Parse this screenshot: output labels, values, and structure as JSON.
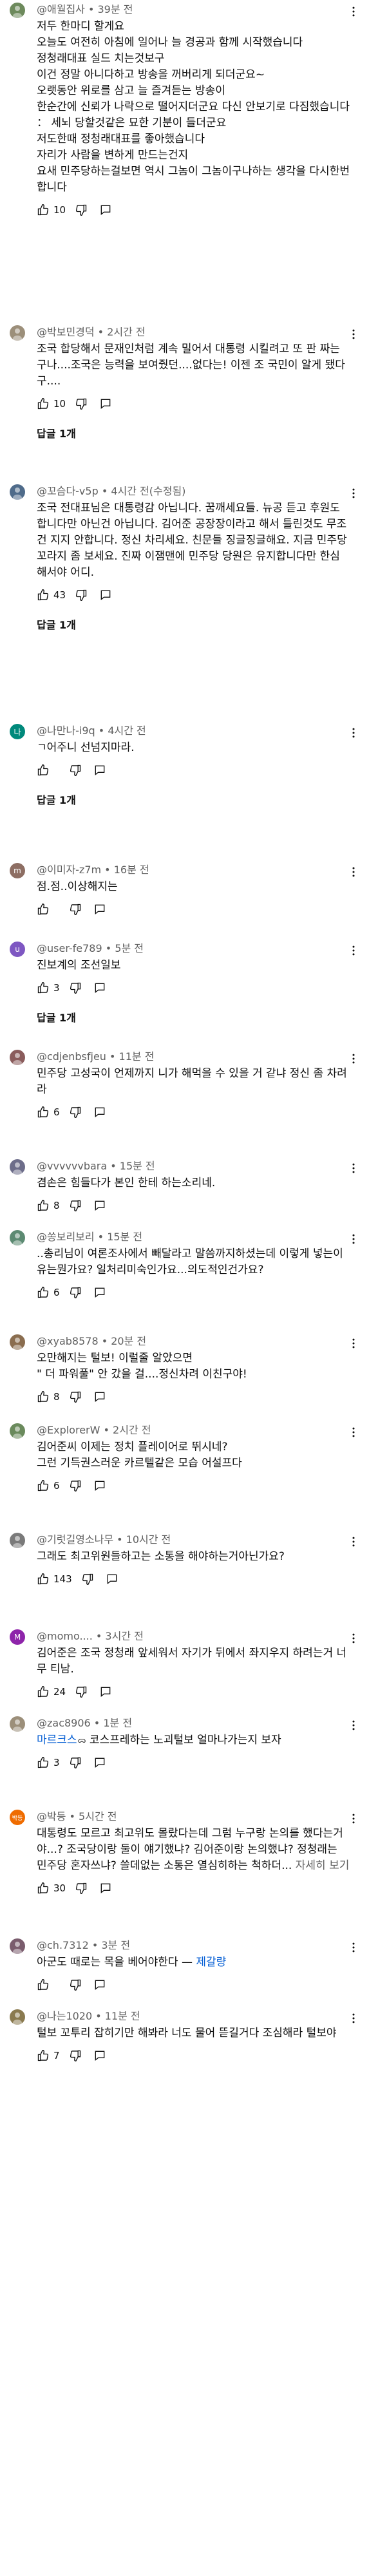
{
  "colors": {
    "meta": "#606060",
    "text": "#0f0f0f",
    "link": "#065fd4"
  },
  "comments": [
    {
      "avatar": "photo",
      "meta": "@애월집사 • 39분 전",
      "text": "저두 한마디 할게요\n오늘도 여전히 아침에 일어나 늘 경공과 함께 시작했습니다\n정청래대표 실드 치는것보구\n이건 정말 아니다하고 방송을 꺼버리게 되더군요~\n오랫동안 위로를 삼고 늘 즐겨듣는 방송이\n한순간에 신뢰가 나락으로 떨어지더군요 다신 안보기로 다짐했습니다 ： 세뇌 당할것같은 묘한 기분이 들더군요\n저도한때 정청래대표를 좋아했습니다\n자리가 사람을 변하게 만드는건지\n요새 민주당하는걸보면 역시 그놈이 그놈이구나하는 생각을 다시한번합니다",
      "likes": "10",
      "replies": ""
    },
    {
      "avatar": "photo",
      "meta": "@박보민경덕 • 2시간 전",
      "text": "조국 합당해서 문재인처럼 계속 밀어서 대통령 시킬려고 또 판 짜는구나....조국은 능력을 보여줬던....없다는! 이젠 조 국민이 알게 됐다구....",
      "likes": "10",
      "replies": "답글 1개"
    },
    {
      "avatar": "photo",
      "meta": "@꼬슴다-v5p • 4시간 전(수정됨)",
      "text": "조국 전대표님은 대통령감 아닙니다. 꿈깨세요들. 뉴공 듣고 후원도 합니다만 아닌건 아닙니다. 김어준 공장장이라고 해서 틀린것도 무조건 지지 안합니다. 정신 차리세요. 친문들 징글징글해요. 지금 민주당 꼬라지 좀 보세요. 진짜 이잼맨에 민주당 당원은 유지합니다만 한심해서야 어디.",
      "likes": "43",
      "replies": "답글 1개"
    },
    {
      "avatar": "letter",
      "letter": "나",
      "avatarColor": "#00897b",
      "meta": "@나만나-i9q • 4시간 전",
      "text": "ㄱ어주니 선넘지마라.",
      "likes": "",
      "replies": "답글 1개"
    },
    {
      "avatar": "letter",
      "letter": "m",
      "avatarColor": "#8d6e63",
      "meta": "@이미자-z7m • 16분 전",
      "text": "점.점..이상해지는",
      "likes": "",
      "replies": ""
    },
    {
      "avatar": "letter",
      "letter": "u",
      "avatarColor": "#7e57c2",
      "meta": "@user-fe789 • 5분 전",
      "text": "진보계의 조선일보",
      "likes": "3",
      "replies": "답글 1개"
    },
    {
      "avatar": "photo",
      "meta": "@cdjenbsfjeu • 11분 전",
      "text": "민주당 고성국이 언제까지 니가 해먹을 수 있을 거 같냐 정신 좀 차려라",
      "likes": "6",
      "replies": ""
    },
    {
      "avatar": "photo",
      "meta": "@vvvvvvbara • 15분 전",
      "text": "겸손은 힘들다가 본인 한테 하는소리네.",
      "likes": "8",
      "replies": ""
    },
    {
      "avatar": "photo",
      "meta": "@쏭보리보리 • 15분 전",
      "text": "..총리님이 여론조사에서 빼달라고 말씀까지하셨는데 이렇게 넣는이유는뭔가요? 일처리미숙인가요...의도적인건가요?",
      "likes": "6",
      "replies": ""
    },
    {
      "avatar": "photo",
      "meta": "@xyab8578 • 20분 전",
      "text": "오만해지는 털보! 이럴줄 알았으면\n\" 더 파워풀\" 안 갔을 걸....정신차려 이친구야!",
      "likes": "8",
      "replies": ""
    },
    {
      "avatar": "photo",
      "meta": "@ExplorerW • 2시간 전",
      "text": "김어준씨 이제는 정치 플레이어로 뛰시네?\n그런 기득권스러운 카르텔같은 모습 어설프다",
      "likes": "6",
      "replies": ""
    },
    {
      "avatar": "photo",
      "meta": "@기럿길영소나무 • 10시간 전",
      "text": "그래도 최고위원들하고는 소통을 해야하는거아닌가요?",
      "likes": "143",
      "replies": ""
    },
    {
      "avatar": "letter",
      "letter": "M",
      "avatarColor": "#8e24aa",
      "meta": "@momo.... • 3시간 전",
      "text": "김어준은 조국 정청래 앞세워서 자기가 뒤에서 좌지우지 하려는거 너무 티남.",
      "likes": "24",
      "replies": ""
    },
    {
      "avatar": "photo",
      "meta": "@zac8906 • 1분 전",
      "text": "",
      "mention": "마르크스",
      "tail": "코스프레하는 노괴털보 얼마나가는지 보자",
      "likes": "3",
      "replies": ""
    },
    {
      "avatar": "letter",
      "letter": "박등",
      "avatarColor": "#ef6c00",
      "meta": "@박등 • 5시간 전",
      "text": "대통령도 모르고 최고위도 몰랐다는데 그럼 누구랑 논의를 했다는거야...? 조국당이랑 둘이 얘기했냐? 김어준이랑 논의했냐? 정청래는 민주당 혼자쓰냐? 쓸데없는 소통은 열심히하는 척하더...",
      "more": "자세히 보기",
      "likes": "30",
      "replies": ""
    },
    {
      "avatar": "photo",
      "meta": "@ch.7312 • 3분 전",
      "text": "아군도 때로는 목을 베어야한다 ",
      "mention2": "제갈량",
      "likes": "",
      "replies": ""
    },
    {
      "avatar": "photo",
      "meta": "@나는1020 • 11분 전",
      "text": "털보 꼬투리 잡히기만 해봐라 너도 물어 뜯길거다 조심해라 털보야",
      "likes": "7",
      "replies": ""
    }
  ]
}
